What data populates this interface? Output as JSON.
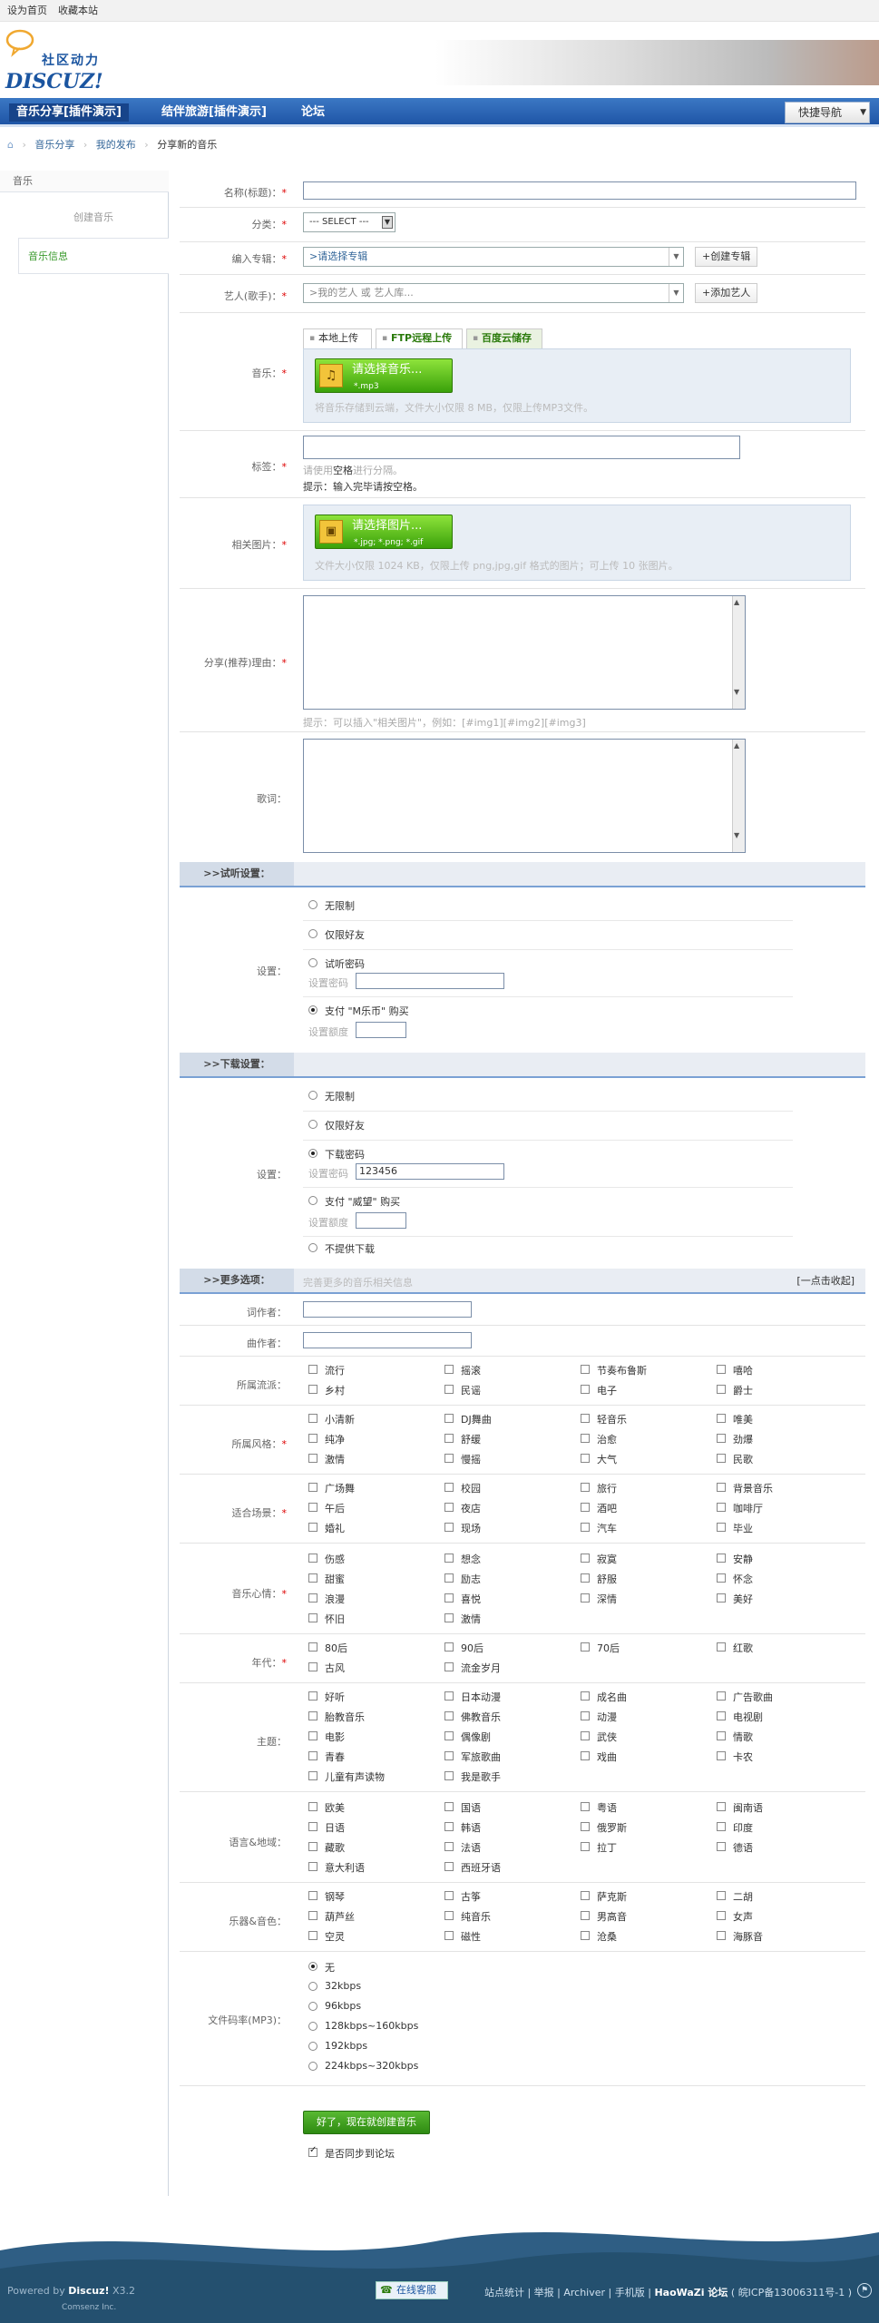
{
  "topbar": {
    "home": "设为首页",
    "fav": "收藏本站"
  },
  "logo": {
    "cn": "社区动力",
    "en": "DISCUZ!"
  },
  "nav": {
    "items": [
      "音乐分享[插件演示]",
      "结伴旅游[插件演示]",
      "论坛"
    ],
    "quick": "快捷导航"
  },
  "crumb": {
    "items": [
      "音乐分享",
      "我的发布",
      "分享新的音乐"
    ]
  },
  "sidebar": {
    "head": "音乐",
    "items": [
      "创建音乐",
      "音乐信息"
    ]
  },
  "form": {
    "title_label": "名称(标题)：",
    "category_label": "分类：",
    "category_value": "--- SELECT ---",
    "album_label": "编入专辑：",
    "album_value": ">请选择专辑",
    "album_btn": "+创建专辑",
    "artist_label": "艺人(歌手)：",
    "artist_placeholder": ">我的艺人 或 艺人库...",
    "artist_btn": "+添加艺人",
    "music_label": "音乐：",
    "tabs": [
      "本地上传",
      "FTP远程上传",
      "百度云储存"
    ],
    "music_btn": "请选择音乐...",
    "music_ext": "*.mp3",
    "music_hint": "将音乐存储到云端，文件大小仅限 8 MB，仅限上传MP3文件。",
    "tag_label": "标签：",
    "tag_hint1": "请使用",
    "tag_hint_key": "空格",
    "tag_hint2": "进行分隔。",
    "tag_tip": "提示：输入完毕请按空格。",
    "pic_label": "相关图片：",
    "pic_btn": "请选择图片...",
    "pic_ext": "*.jpg; *.png; *.gif",
    "pic_hint": "文件大小仅限 1024 KB，仅限上传 png,jpg,gif 格式的图片；可上传 10 张图片。",
    "reason_label": "分享(推荐)理由：",
    "reason_hint": "提示：可以插入\"相关图片\"，例如：[#img1][#img2][#img3]",
    "lyric_label": "歌词："
  },
  "listen": {
    "title": ">>试听设置：",
    "label": "设置：",
    "options": [
      "无限制",
      "仅限好友",
      "试听密码",
      "支付 \"M乐币\" 购买"
    ],
    "pwd_label": "设置密码",
    "price_label": "设置额度"
  },
  "download": {
    "title": ">>下载设置：",
    "label": "设置：",
    "options": [
      "无限制",
      "仅限好友",
      "下载密码",
      "支付 \"威望\" 购买",
      "不提供下载"
    ],
    "pwd_label": "设置密码",
    "pwd_value": "123456",
    "price_label": "设置额度"
  },
  "more": {
    "title": ">>更多选项：",
    "desc": "完善更多的音乐相关信息",
    "collapse": "[一点击收起]",
    "lyricist_label": "词作者：",
    "composer_label": "曲作者：",
    "school_label": "所属流派：",
    "school": [
      "流行",
      "摇滚",
      "节奏布鲁斯",
      "嘻哈",
      "乡村",
      "民谣",
      "电子",
      "爵士"
    ],
    "style_label": "所属风格：",
    "style": [
      "小清新",
      "DJ舞曲",
      "轻音乐",
      "唯美",
      "纯净",
      "舒缓",
      "治愈",
      "劲爆",
      "激情",
      "慢摇",
      "大气",
      "民歌"
    ],
    "scene_label": "适合场景：",
    "scene": [
      "广场舞",
      "校园",
      "旅行",
      "背景音乐",
      "午后",
      "夜店",
      "酒吧",
      "咖啡厅",
      "婚礼",
      "现场",
      "汽车",
      "毕业"
    ],
    "mood_label": "音乐心情：",
    "mood": [
      "伤感",
      "想念",
      "寂寞",
      "安静",
      "甜蜜",
      "励志",
      "舒服",
      "怀念",
      "浪漫",
      "喜悦",
      "深情",
      "美好",
      "怀旧",
      "激情"
    ],
    "era_label": "年代：",
    "era": [
      "80后",
      "90后",
      "70后",
      "红歌",
      "古风",
      "流金岁月"
    ],
    "theme_label": "主题：",
    "theme": [
      "好听",
      "日本动漫",
      "成名曲",
      "广告歌曲",
      "胎教音乐",
      "佛教音乐",
      "动漫",
      "电视剧",
      "电影",
      "偶像剧",
      "武侠",
      "情歌",
      "青春",
      "军旅歌曲",
      "戏曲",
      "卡农",
      "儿童有声读物",
      "我是歌手"
    ],
    "lang_label": "语言&地域：",
    "lang": [
      "欧美",
      "国语",
      "粤语",
      "闽南语",
      "日语",
      "韩语",
      "俄罗斯",
      "印度",
      "藏歌",
      "法语",
      "拉丁",
      "德语",
      "意大利语",
      "西班牙语"
    ],
    "inst_label": "乐器&音色：",
    "inst": [
      "钢琴",
      "古筝",
      "萨克斯",
      "二胡",
      "葫芦丝",
      "纯音乐",
      "男高音",
      "女声",
      "空灵",
      "磁性",
      "沧桑",
      "海豚音"
    ],
    "bitrate_label": "文件码率(MP3)：",
    "bitrate": [
      "无",
      "32kbps",
      "96kbps",
      "128kbps~160kbps",
      "192kbps",
      "224kbps~320kbps"
    ]
  },
  "submit": {
    "label": "好了，现在就创建音乐",
    "sync": "是否同步到论坛"
  },
  "footer": {
    "powered": "Powered by",
    "brand": "Discuz!",
    "ver": "X3.2",
    "company": "Comsenz Inc.",
    "online": "在线客服",
    "links": [
      "站点统计",
      "举报",
      "Archiver",
      "手机版",
      "HaoWaZi 论坛",
      "皖ICP备13006311号-1"
    ]
  }
}
